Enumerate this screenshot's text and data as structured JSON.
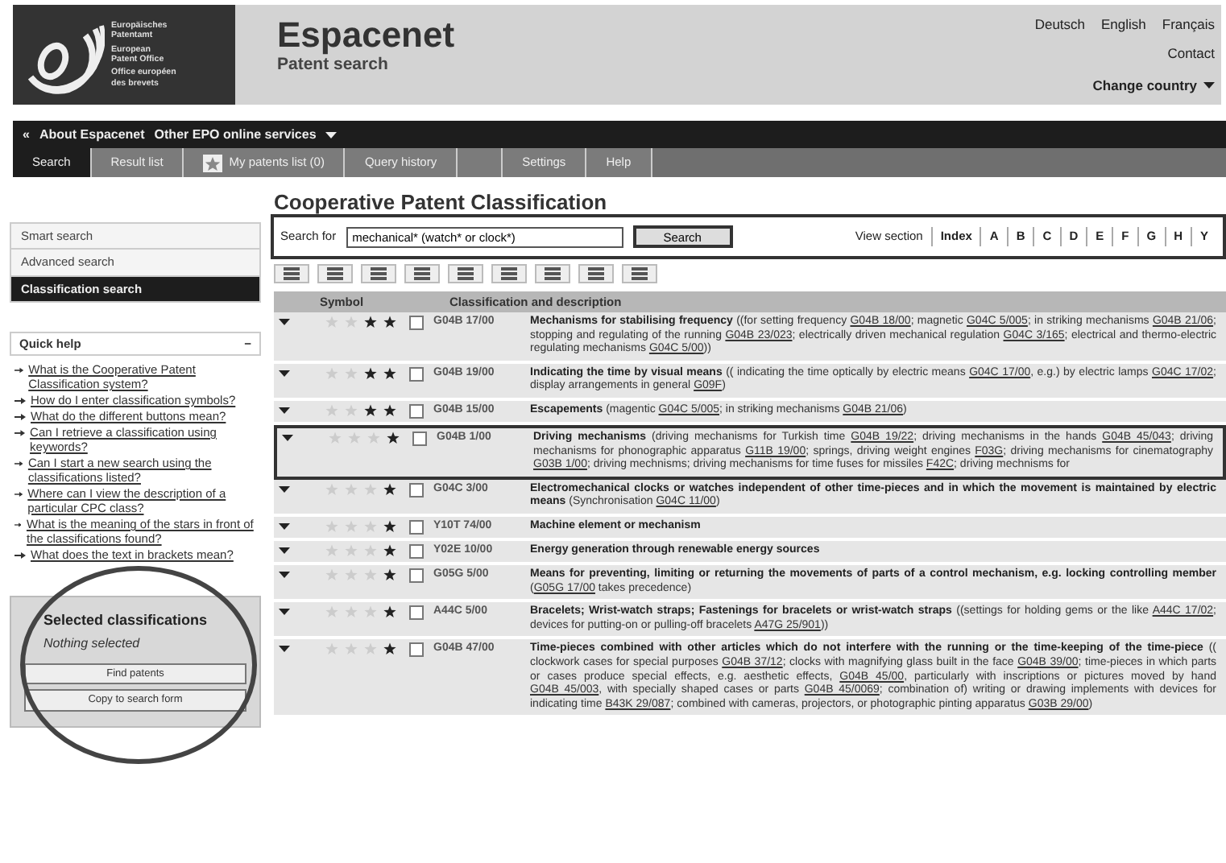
{
  "logo": {
    "lines": [
      "Europäisches",
      "Patentamt",
      "European",
      "Patent Office",
      "Office européen",
      "des brevets"
    ]
  },
  "header": {
    "title": "Espacenet",
    "subtitle": "Patent search",
    "languages": [
      "Deutsch",
      "English",
      "Français"
    ],
    "contact": "Contact",
    "change_country": "Change country"
  },
  "top_nav": {
    "back": "«",
    "items": [
      "About Espacenet",
      "Other EPO online services"
    ]
  },
  "tabs": [
    {
      "label": "Search",
      "selected": true
    },
    {
      "label": "Result list",
      "selected": false
    },
    {
      "label": "My patents list (0)",
      "selected": false,
      "kind": "star"
    },
    {
      "label": "Query history",
      "selected": false
    },
    {
      "selected": false,
      "kind": "blank"
    },
    {
      "label": "Settings",
      "selected": false
    },
    {
      "label": "Help",
      "selected": false
    }
  ],
  "sidebar": {
    "modes": [
      {
        "label": "Smart search",
        "selected": false
      },
      {
        "label": "Advanced search",
        "selected": false
      },
      {
        "label": "Classification search",
        "selected": true
      }
    ],
    "quick_help": {
      "title": "Quick help",
      "toggle": "−",
      "links": [
        "What is the Cooperative Patent Classification system?",
        "How do I enter classification symbols?",
        "What do the different buttons mean?",
        "Can I retrieve a classification using keywords?",
        "Can I start a new search using the classifications listed?",
        "Where can I view the description of a particular CPC class?",
        "What is the meaning of the stars in front of the classifications found?",
        "What does the text in brackets mean?"
      ]
    },
    "selected": {
      "title": "Selected classifications",
      "empty": "Nothing selected",
      "buttons": [
        "Find patents",
        "Copy to search form"
      ]
    }
  },
  "main": {
    "title": "Cooperative Patent Classification",
    "search_label": "Search for",
    "search_value": "mechanical* (watch* or clock*)",
    "search_button": "Search",
    "view_section": "View section",
    "sections": [
      "Index",
      "A",
      "B",
      "C",
      "D",
      "E",
      "F",
      "G",
      "H",
      "Y"
    ],
    "columns": [
      "Symbol",
      "Classification and description"
    ],
    "rows": [
      {
        "symbol": "G04B 17/00",
        "stars": 2,
        "checked": false,
        "highlighted": false,
        "title": "Mechanisms for stabilising frequency",
        "rest": [
          " ((for setting frequency ",
          {
            "link": "G04B 18/00"
          },
          "; magnetic ",
          {
            "link": "G04C 5/005"
          },
          "; in striking mechanisms ",
          {
            "link": "G04B 21/06"
          },
          "; stopping and regulating of the running ",
          {
            "link": "G04B 23/023"
          },
          "; electrically driven mechanical regulation ",
          {
            "link": "G04C 3/165"
          },
          "; electrical and thermo-electric regulating mechanisms ",
          {
            "link": "G04C 5/00"
          },
          "))"
        ]
      },
      {
        "symbol": "G04B 19/00",
        "stars": 2,
        "checked": false,
        "highlighted": false,
        "title": "Indicating the time by visual means",
        "rest": [
          " (( indicating the time optically by electric means ",
          {
            "link": "G04C 17/00"
          },
          ", e.g.) by electric lamps ",
          {
            "link": "G04C 17/02"
          },
          "; display arrangements in general ",
          {
            "link": "G09F"
          },
          ")"
        ]
      },
      {
        "symbol": "G04B 15/00",
        "stars": 2,
        "checked": false,
        "highlighted": false,
        "title": "Escapements",
        "rest": [
          " (magentic ",
          {
            "link": "G04C 5/005"
          },
          "; in striking mechanisms ",
          {
            "link": "G04B 21/06"
          },
          ")"
        ]
      },
      {
        "symbol": "G04B 1/00",
        "stars": 1,
        "checked": false,
        "highlighted": true,
        "title": "Driving mechanisms",
        "rest": [
          " (driving mechanisms for Turkish time ",
          {
            "link": "G04B 19/22"
          },
          "; driving mechanisms in the hands ",
          {
            "link": "G04B 45/043"
          },
          "; driving mechanisms for phonographic apparatus ",
          {
            "link": "G11B 19/00"
          },
          "; springs, driving weight engines ",
          {
            "link": "F03G"
          },
          "; driving mechanisms for cinematography ",
          {
            "link": "G03B 1/00"
          },
          "; driving mechnisms; driving mechanisms for time fuses for missiles ",
          {
            "link": "F42C"
          },
          "; driving mechnisms for"
        ]
      },
      {
        "symbol": "G04C 3/00",
        "stars": 1,
        "checked": false,
        "highlighted": false,
        "title": "Electromechanical clocks or watches independent of other time-pieces and in which the movement is maintained by electric means",
        "rest": [
          " (Synchronisation ",
          {
            "link": "G04C 11/00"
          },
          ")"
        ]
      },
      {
        "symbol": "Y10T 74/00",
        "stars": 1,
        "checked": false,
        "highlighted": false,
        "title": "Machine element or mechanism",
        "rest": []
      },
      {
        "symbol": "Y02E 10/00",
        "stars": 1,
        "checked": false,
        "highlighted": false,
        "title": "Energy generation through renewable energy sources",
        "rest": []
      },
      {
        "symbol": "G05G 5/00",
        "stars": 1,
        "checked": false,
        "highlighted": false,
        "title": "Means for preventing, limiting or returning the movements of parts of a control mechanism, e.g. locking controlling member",
        "rest": [
          " (",
          {
            "link": "G05G 17/00"
          },
          " takes precedence)"
        ]
      },
      {
        "symbol": "A44C 5/00",
        "stars": 1,
        "checked": false,
        "highlighted": false,
        "title": "Bracelets; Wrist-watch straps; Fastenings for bracelets or wrist-watch straps",
        "rest": [
          " ((settings for holding gems or the like ",
          {
            "link": "A44C 17/02"
          },
          "; devices for putting-on or pulling-off bracelets ",
          {
            "link": "A47G 25/901"
          },
          "))"
        ]
      },
      {
        "symbol": "G04B 47/00",
        "stars": 1,
        "checked": false,
        "highlighted": false,
        "title": "Time-pieces combined with other articles which do not interfere with the running or the time-keeping of the time-piece",
        "rest": [
          " (( clockwork cases for special purposes ",
          {
            "link": "G04B 37/12"
          },
          "; clocks with magnifying glass built in the face ",
          {
            "link": "G04B 39/00"
          },
          "; time-pieces in which parts or cases produce special effects, e.g. aesthetic effects, ",
          {
            "link": "G04B 45/00"
          },
          ", particularly with inscriptions or pictures moved by hand ",
          {
            "link": "G04B 45/003"
          },
          ", with specially shaped cases or parts ",
          {
            "link": "G04B 45/0069"
          },
          "; combination of) writing or drawing implements with devices for indicating time ",
          {
            "link": "B43K 29/087"
          },
          "; combined with cameras, projectors, or photographic pinting apparatus ",
          {
            "link": "G03B 29/00"
          },
          ")"
        ]
      }
    ]
  }
}
